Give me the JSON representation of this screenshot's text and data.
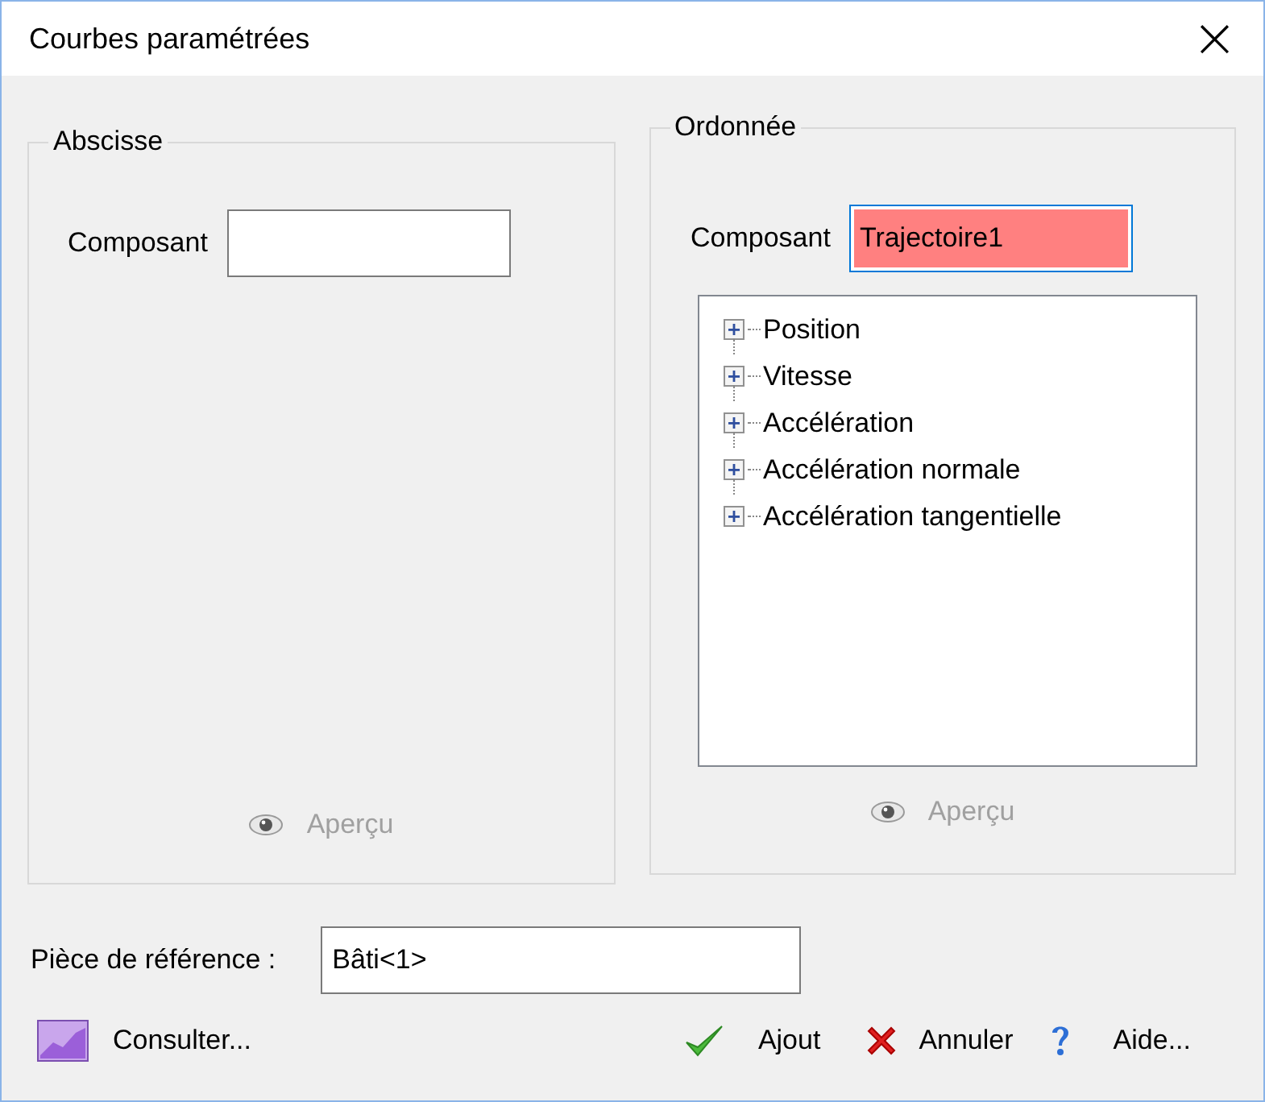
{
  "window": {
    "title": "Courbes paramétrées",
    "close": "×"
  },
  "abscissa": {
    "title": "Abscisse",
    "component_label": "Composant",
    "invalid": false,
    "preview": {
      "label": "Aperçu",
      "disabled": true
    }
  },
  "ordinate": {
    "title": "Ordonnée",
    "component_label": "Composant",
    "component_value": "Trajectoire1",
    "invalid": true,
    "tree": [
      {
        "label": "Position",
        "expanded": false
      },
      {
        "label": "Vitesse",
        "expanded": false
      },
      {
        "label": "Accélération",
        "expanded": false
      },
      {
        "label": "Accélération normale",
        "expanded": false
      },
      {
        "label": "Accélération tangentielle",
        "expanded": false
      }
    ],
    "preview": {
      "label": "Aperçu",
      "disabled": true
    }
  },
  "reference": {
    "label": "Pièce de référence :",
    "value": "Bâti<1>"
  },
  "buttons": [
    {
      "kind": "chart",
      "label": "Consulter..."
    },
    {
      "kind": "add",
      "label": "Ajout"
    },
    {
      "kind": "cancel",
      "label": "Annuler"
    },
    {
      "kind": "help",
      "label": "Aide..."
    }
  ]
}
